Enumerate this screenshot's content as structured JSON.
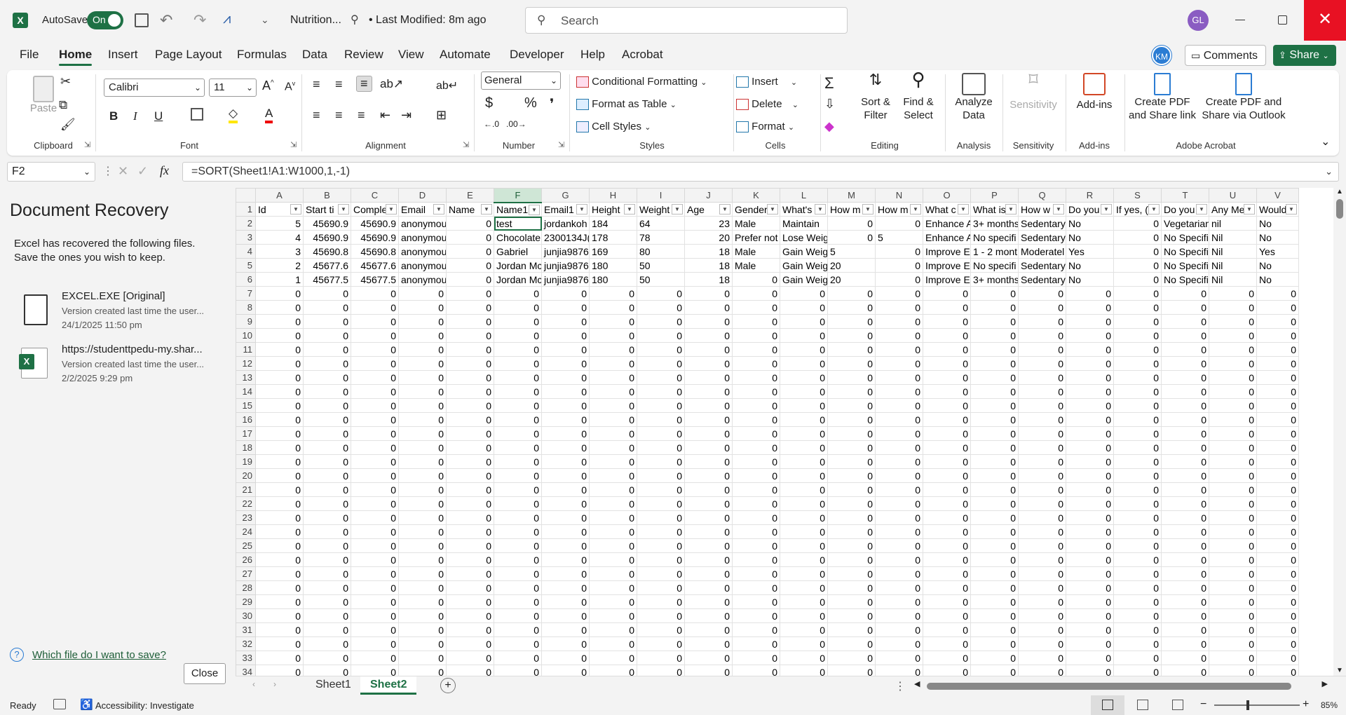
{
  "titlebar": {
    "autosave_label": "AutoSave",
    "autosave_state": "On",
    "filename": "Nutrition...",
    "modified": "• Last Modified: 8m ago",
    "search_placeholder": "Search",
    "user_initials": "GL"
  },
  "menu": {
    "items": [
      "File",
      "Home",
      "Insert",
      "Page Layout",
      "Formulas",
      "Data",
      "Review",
      "View",
      "Automate",
      "Developer",
      "Help",
      "Acrobat"
    ],
    "active": "Home",
    "account_initials": "KM",
    "comments_label": "Comments",
    "share_label": "Share"
  },
  "ribbon": {
    "clipboard": {
      "paste": "Paste",
      "label": "Clipboard"
    },
    "font": {
      "name": "Calibri",
      "size": "11",
      "label": "Font"
    },
    "alignment": {
      "label": "Alignment"
    },
    "number": {
      "format": "General",
      "label": "Number"
    },
    "styles": {
      "conditional": "Conditional Formatting",
      "table": "Format as Table",
      "cell": "Cell Styles",
      "label": "Styles"
    },
    "cells": {
      "insert": "Insert",
      "delete": "Delete",
      "format": "Format",
      "label": "Cells"
    },
    "editing": {
      "sort": "Sort &",
      "sort2": "Filter",
      "find": "Find &",
      "find2": "Select",
      "label": "Editing"
    },
    "analysis": {
      "btn": "Analyze",
      "btn2": "Data",
      "label": "Analysis"
    },
    "sensitivity": {
      "btn": "Sensitivity",
      "label": "Sensitivity"
    },
    "addins": {
      "btn": "Add-ins",
      "label": "Add-ins"
    },
    "acrobat": {
      "pdf1": "Create PDF",
      "pdf1b": "and Share link",
      "pdf2": "Create PDF and",
      "pdf2b": "Share via Outlook",
      "label": "Adobe Acrobat"
    }
  },
  "formula_bar": {
    "cell_ref": "F2",
    "formula": "=SORT(Sheet1!A1:W1000,1,-1)"
  },
  "recovery": {
    "title": "Document Recovery",
    "description": "Excel has recovered the following files. Save the ones you wish to keep.",
    "files": [
      {
        "name": "EXCEL.EXE  [Original]",
        "detail": "Version created last time the user...",
        "date": "24/1/2025 11:50 pm",
        "icon": "blank-document-icon"
      },
      {
        "name": "https://studenttpedu-my.shar...",
        "detail": "Version created last time the user...",
        "date": "2/2/2025 9:29 pm",
        "icon": "excel-file-icon"
      }
    ],
    "help_link": "Which file do I want to save?",
    "close_label": "Close"
  },
  "sheet": {
    "columns": [
      "A",
      "B",
      "C",
      "D",
      "E",
      "F",
      "G",
      "H",
      "I",
      "J",
      "K",
      "L",
      "M",
      "N",
      "O",
      "P",
      "Q",
      "R",
      "S",
      "T",
      "U",
      "V"
    ],
    "selected_column": "F",
    "headers": [
      "Id",
      "Start ti",
      "Comple",
      "Email",
      "Name",
      "Name1",
      "Email1",
      "Height",
      "Weight",
      "Age",
      "Gender",
      "What's",
      "How m",
      "How m",
      "What c",
      "What is",
      "How w",
      "Do you",
      "If yes, (",
      "Do you",
      "Any Me",
      "Would"
    ],
    "rows": [
      [
        "5",
        "45690.9",
        "45690.9",
        "anonymou",
        "0",
        "test",
        "jordankoh",
        "184",
        "64",
        "23",
        "Male",
        "Maintain",
        "0",
        "0",
        "Enhance A",
        "3+ months",
        "Sedentary",
        "No",
        "0",
        "Vegetarian",
        "nil",
        "No"
      ],
      [
        "4",
        "45690.9",
        "45690.9",
        "anonymou",
        "0",
        "Chocolate",
        "2300134J(",
        "178",
        "78",
        "20",
        "Prefer not",
        "Lose Weig",
        "0",
        "5",
        "Enhance A",
        "No specifi",
        "Sedentary",
        "No",
        "0",
        "No Specifi",
        "Nil",
        "No"
      ],
      [
        "3",
        "45690.8",
        "45690.8",
        "anonymou",
        "0",
        "Gabriel",
        "junjia9876",
        "169",
        "80",
        "18",
        "Male",
        "Gain Weig",
        "5",
        "0",
        "Improve E",
        "1 - 2 mont",
        "Moderatel",
        "Yes",
        "0",
        "No Specifi",
        "Nil",
        "Yes"
      ],
      [
        "2",
        "45677.6",
        "45677.6",
        "anonymou",
        "0",
        "Jordan Mc",
        "junjia9876",
        "180",
        "50",
        "18",
        "Male",
        "Gain Weig",
        "20",
        "0",
        "Improve E",
        "No specifi",
        "Sedentary",
        "No",
        "0",
        "No Specifi",
        "Nil",
        "No"
      ],
      [
        "1",
        "45677.5",
        "45677.5",
        "anonymou",
        "0",
        "Jordan Mc",
        "junjia9876",
        "180",
        "50",
        "18",
        "0",
        "Gain Weig",
        "20",
        "0",
        "Improve E",
        "3+ months",
        "Sedentary",
        "No",
        "0",
        "No Specifi",
        "Nil",
        "No"
      ]
    ],
    "empty_value": "0",
    "row_numbers_start": 1,
    "row_numbers_end": 34,
    "partial_column": "V"
  },
  "sheet_tabs": [
    "Sheet1",
    "Sheet2"
  ],
  "active_tab": "Sheet2",
  "status": {
    "ready": "Ready",
    "accessibility": "Accessibility: Investigate",
    "zoom": "85%"
  },
  "colors": {
    "accent": "#1e7145",
    "close_red": "#e81123",
    "user_avatar": "#8a5cc2",
    "km_avatar": "#2b7cd3"
  }
}
